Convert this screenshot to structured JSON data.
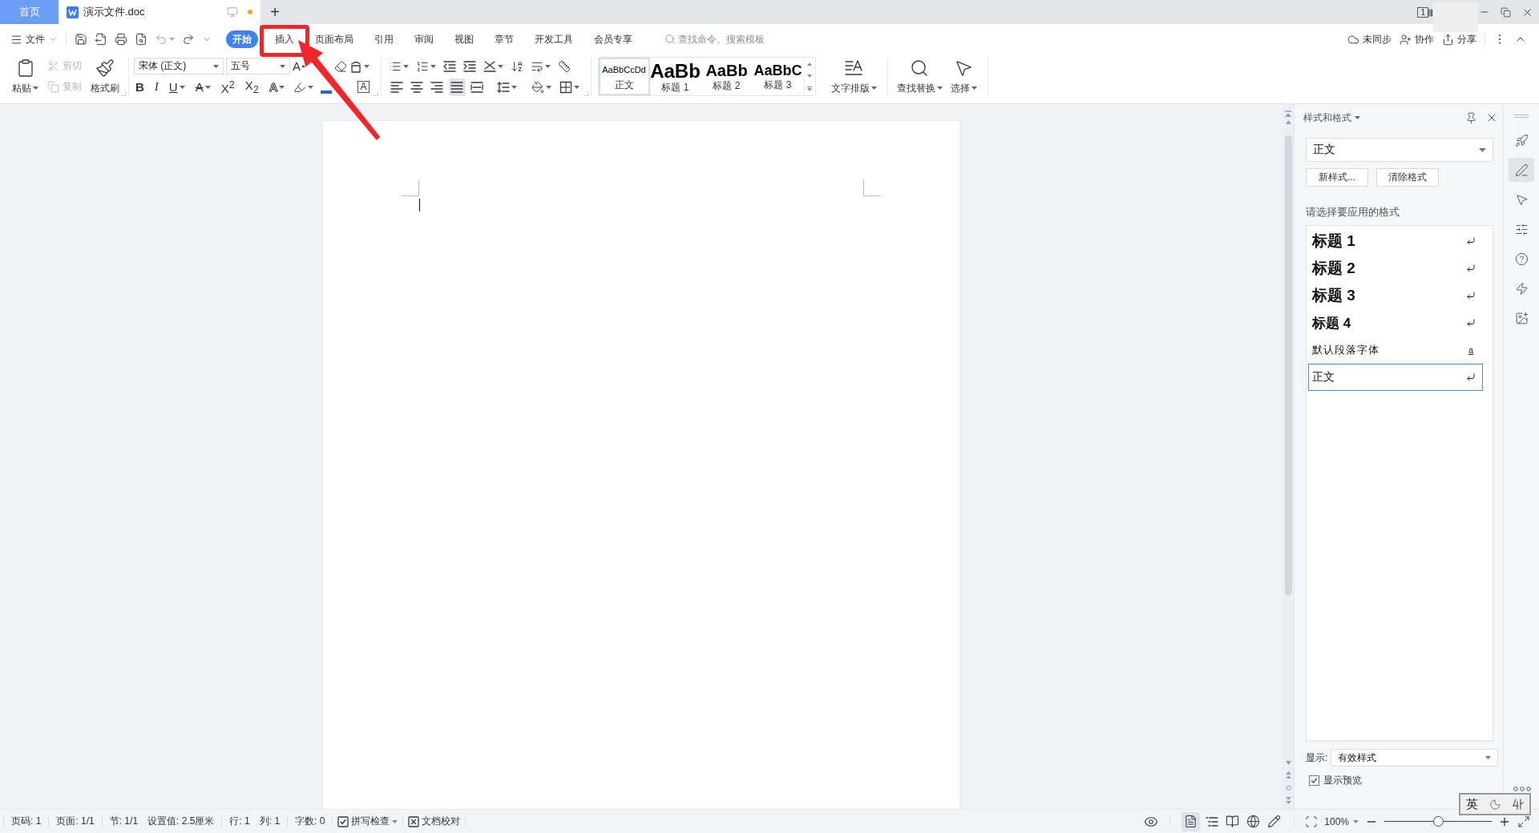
{
  "title_bar": {
    "tabs": [
      {
        "label": "首页",
        "kind": "home",
        "selected": false
      },
      {
        "label": "演示文件.doc",
        "kind": "document",
        "selected": true,
        "unsaved": true
      }
    ],
    "new_tab": "+",
    "window_badge": "1"
  },
  "menu_bar": {
    "file_menu": "文件",
    "tabs": [
      {
        "label": "开始",
        "selected": true,
        "annotated": false
      },
      {
        "label": "插入",
        "selected": false,
        "annotated": true
      },
      {
        "label": "页面布局",
        "selected": false,
        "annotated": false
      },
      {
        "label": "引用",
        "selected": false,
        "annotated": false
      },
      {
        "label": "审阅",
        "selected": false,
        "annotated": false
      },
      {
        "label": "视图",
        "selected": false,
        "annotated": false
      },
      {
        "label": "章节",
        "selected": false,
        "annotated": false
      },
      {
        "label": "开发工具",
        "selected": false,
        "annotated": false
      },
      {
        "label": "会员专享",
        "selected": false,
        "annotated": false
      }
    ],
    "search": {
      "placeholder": "查找命令、搜索模板"
    },
    "actions": [
      {
        "label": "未同步",
        "kind": "sync"
      },
      {
        "label": "协作",
        "kind": "collaborate"
      },
      {
        "label": "分享",
        "kind": "share"
      }
    ]
  },
  "ribbon": {
    "clipboard": [
      {
        "label": "粘贴",
        "kind": "paste",
        "disabled": false
      },
      {
        "label": "剪切",
        "kind": "cut",
        "disabled": true
      },
      {
        "label": "复制",
        "kind": "copy",
        "disabled": true
      },
      {
        "label": "格式刷",
        "kind": "painter",
        "disabled": false
      }
    ],
    "font": {
      "name": "宋体 (正文)",
      "size": "五号",
      "grow": "A",
      "formats": [
        {
          "glyph": "B",
          "kind": "bold",
          "dropdown": false
        },
        {
          "glyph": "I",
          "kind": "italic",
          "dropdown": false
        },
        {
          "glyph": "U",
          "kind": "underline",
          "dropdown": true
        },
        {
          "glyph": "A",
          "kind": "strike",
          "dropdown": true
        },
        {
          "glyph": "X$^{2}$",
          "kind": "superscript",
          "dropdown": false
        },
        {
          "glyph": "X$_{2}$",
          "kind": "subscript",
          "dropdown": false
        },
        {
          "glyph": "A",
          "kind": "outline",
          "dropdown": true
        }
      ],
      "boxed": "A"
    },
    "alignments": [
      {
        "kind": "left",
        "selected": false
      },
      {
        "kind": "center",
        "selected": false
      },
      {
        "kind": "right",
        "selected": false
      },
      {
        "kind": "justify",
        "selected": true
      },
      {
        "kind": "distributed",
        "selected": false
      }
    ],
    "styles": [
      {
        "preview": "AaBbCcDd",
        "label": "正文",
        "kind": "body",
        "selected": true
      },
      {
        "preview": "AaBb",
        "label": "标题 1",
        "kind": "heading1",
        "selected": false
      },
      {
        "preview": "AaBb",
        "label": "标题 2",
        "kind": "heading2",
        "selected": false
      },
      {
        "preview": "AaBbC",
        "label": "标题 3",
        "kind": "heading3",
        "selected": false
      }
    ],
    "tools": [
      {
        "label": "文字排版",
        "kind": "layout"
      },
      {
        "label": "查找替换",
        "kind": "find"
      },
      {
        "label": "选择",
        "kind": "select"
      }
    ]
  },
  "document": {
    "caret_visible": true
  },
  "styles_panel": {
    "title": "样式和格式",
    "current": "正文",
    "buttons": [
      "新样式...",
      "清除格式"
    ],
    "prompt": "请选择要应用的格式",
    "styles": [
      {
        "label": "标题 1",
        "kind": "heading1",
        "selected": false
      },
      {
        "label": "标题 2",
        "kind": "heading2",
        "selected": false
      },
      {
        "label": "标题 3",
        "kind": "heading3",
        "selected": false
      },
      {
        "label": "标题 4",
        "kind": "heading4",
        "selected": false
      },
      {
        "label": "默认段落字体",
        "kind": "character",
        "mark": "a",
        "selected": false
      },
      {
        "label": "正文",
        "kind": "paragraph",
        "selected": true
      }
    ],
    "show_label": "显示:",
    "show_value": "有效样式",
    "preview": {
      "label": "显示预览",
      "checked": true
    }
  },
  "side_tools": [
    {
      "kind": "rocket",
      "selected": false
    },
    {
      "kind": "pen",
      "selected": true
    },
    {
      "kind": "pointer",
      "selected": false
    },
    {
      "kind": "sliders",
      "selected": false
    },
    {
      "kind": "help",
      "selected": false
    },
    {
      "kind": "lightning",
      "selected": false
    },
    {
      "kind": "image",
      "selected": false
    }
  ],
  "status_bar": {
    "groups": [
      [
        "页码: 1"
      ],
      [
        "页面: 1/1"
      ],
      [
        "节: 1/1",
        "设置值: 2.5厘米"
      ],
      [
        "行: 1",
        "列: 1"
      ],
      [
        "字数: 0"
      ]
    ],
    "tools": [
      {
        "label": "拼写检查",
        "kind": "spellcheck",
        "dropdown": true
      },
      {
        "label": "文档校对",
        "kind": "proofread",
        "dropdown": false
      }
    ],
    "views": [
      {
        "kind": "page",
        "selected": true
      },
      {
        "kind": "outline",
        "selected": false
      },
      {
        "kind": "reading",
        "selected": false
      },
      {
        "kind": "web",
        "selected": false
      },
      {
        "kind": "writing",
        "selected": false
      }
    ],
    "zoom": {
      "value": "100%",
      "level": 0.5
    }
  },
  "ime": {
    "mode": "英"
  }
}
